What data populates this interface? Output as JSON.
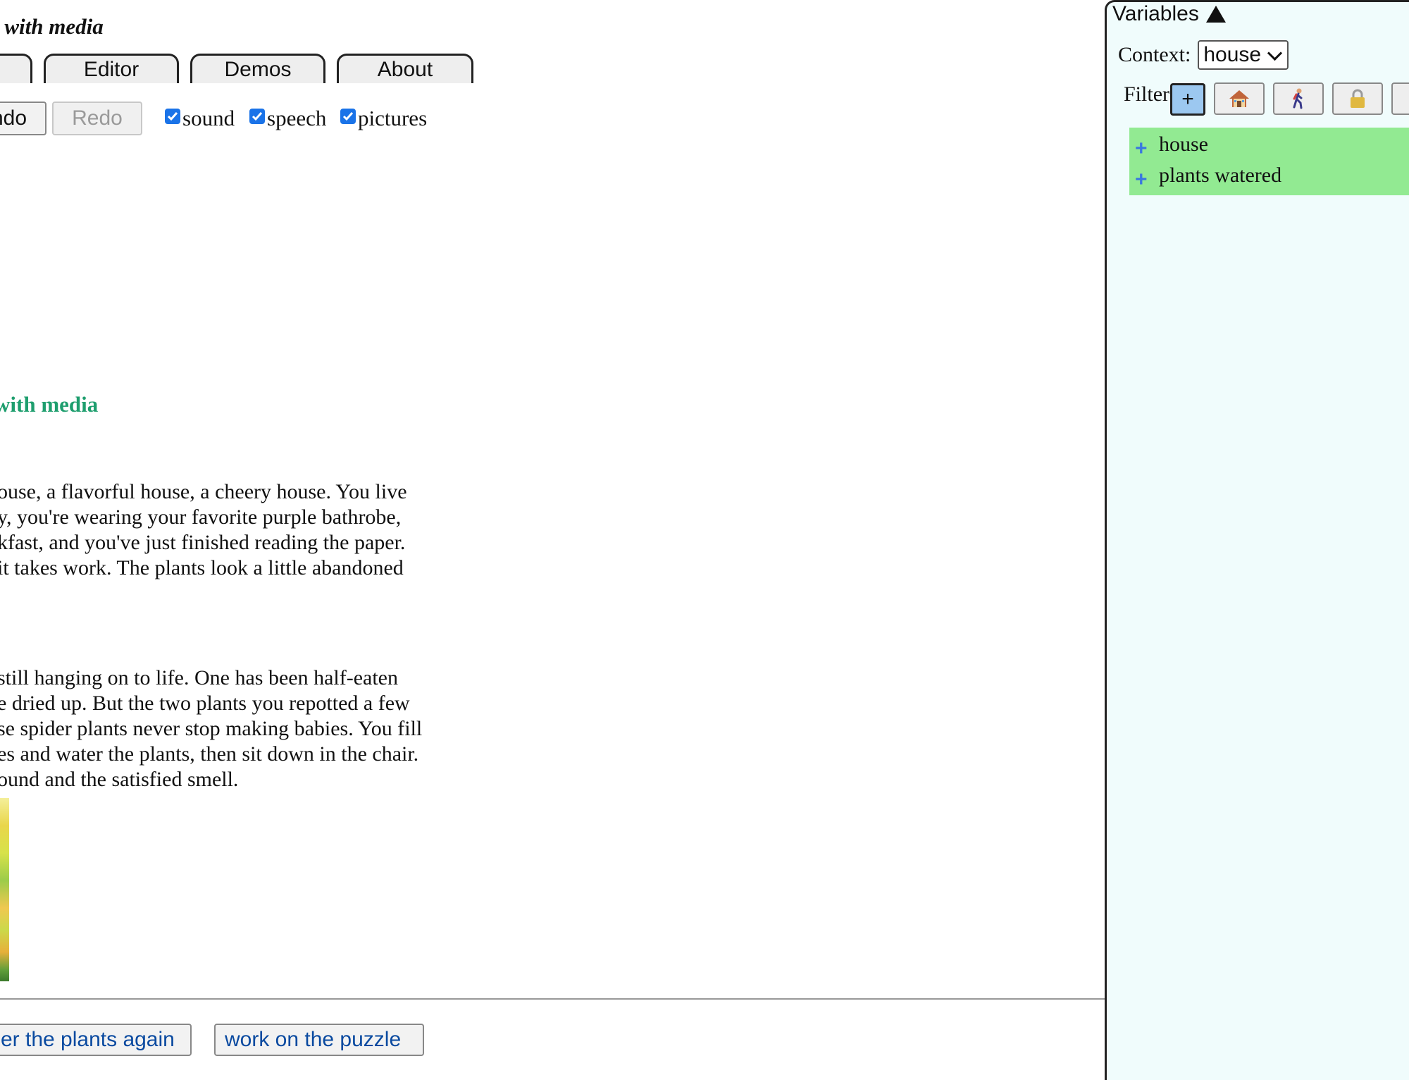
{
  "story": {
    "title": "l with media",
    "tabs": [
      "",
      "Editor",
      "Demos",
      "About"
    ],
    "toolbar": {
      "undo_label": "ndo",
      "redo_label": "Redo",
      "options": [
        {
          "label": "sound",
          "checked": true
        },
        {
          "label": "speech",
          "checked": true
        },
        {
          "label": "pictures",
          "checked": true
        }
      ]
    },
    "section_title": "with media",
    "paragraph1": [
      "ouse, a flavorful house, a cheery house. You live",
      "y, you're wearing your favorite purple bathrobe,",
      "kfast, and you've just finished reading the paper.",
      "it takes work. The plants look a little abandoned"
    ],
    "paragraph2": [
      "still hanging on to life. One has been half-eaten",
      "e dried up. But the two plants you repotted a few",
      "se spider plants never stop making babies. You fill",
      "es and water the plants, then sit down in the chair.",
      "ound and the satisfied smell."
    ],
    "choices": [
      "er the plants again",
      "work on the puzzle"
    ]
  },
  "variables": {
    "header": "Variables",
    "context_label": "Context:",
    "context_value": "house",
    "filter_label": "Filter:",
    "filter_buttons": [
      "+",
      "house-icon",
      "person-walking-icon",
      "lock-icon"
    ],
    "items": [
      "house",
      "plants watered"
    ]
  },
  "colors": {
    "section_title": "#1e9e6e",
    "choice_text": "#0a4aa0",
    "checkbox": "#1a73e8",
    "panel_bg": "#f0fcfc",
    "var_list_bg": "#92ea92"
  }
}
